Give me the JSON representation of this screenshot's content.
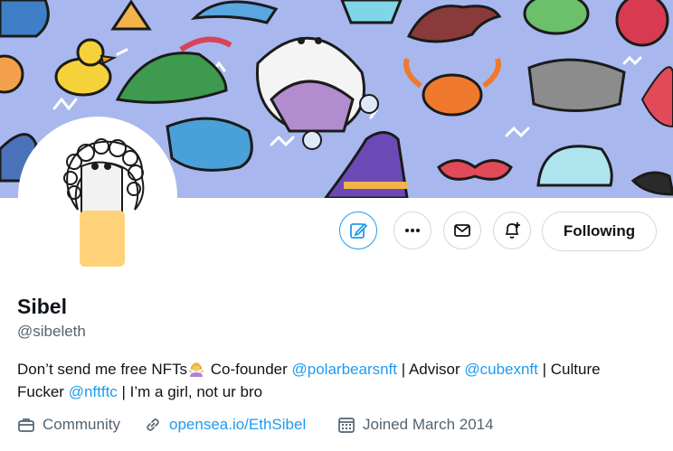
{
  "profile": {
    "display_name": "Sibel",
    "handle": "@sibeleth",
    "bio": {
      "part1": "Don’t send me free NFTs",
      "emoji_icon": "woman-shrugging-emoji",
      "part2": " Co-founder ",
      "mention1": "@polarbearsnft",
      "part3": " | Advisor ",
      "mention2": "@cubexnft",
      "part4": " | Culture Fucker ",
      "mention3": "@nftftc",
      "part5": " | I’m a girl, not ur bro"
    },
    "meta": {
      "category": "Community",
      "website": "opensea.io/EthSibel",
      "joined": "Joined March 2014"
    }
  },
  "actions": {
    "edit_icon": "edit-icon",
    "more_icon": "more-icon",
    "message_icon": "mail-icon",
    "notify_icon": "bell-plus-icon",
    "follow_label": "Following"
  },
  "colors": {
    "accent": "#1d9bf0",
    "banner_bg": "#a8b8ee",
    "secondary_text": "#536471",
    "border": "#cfd9de"
  }
}
